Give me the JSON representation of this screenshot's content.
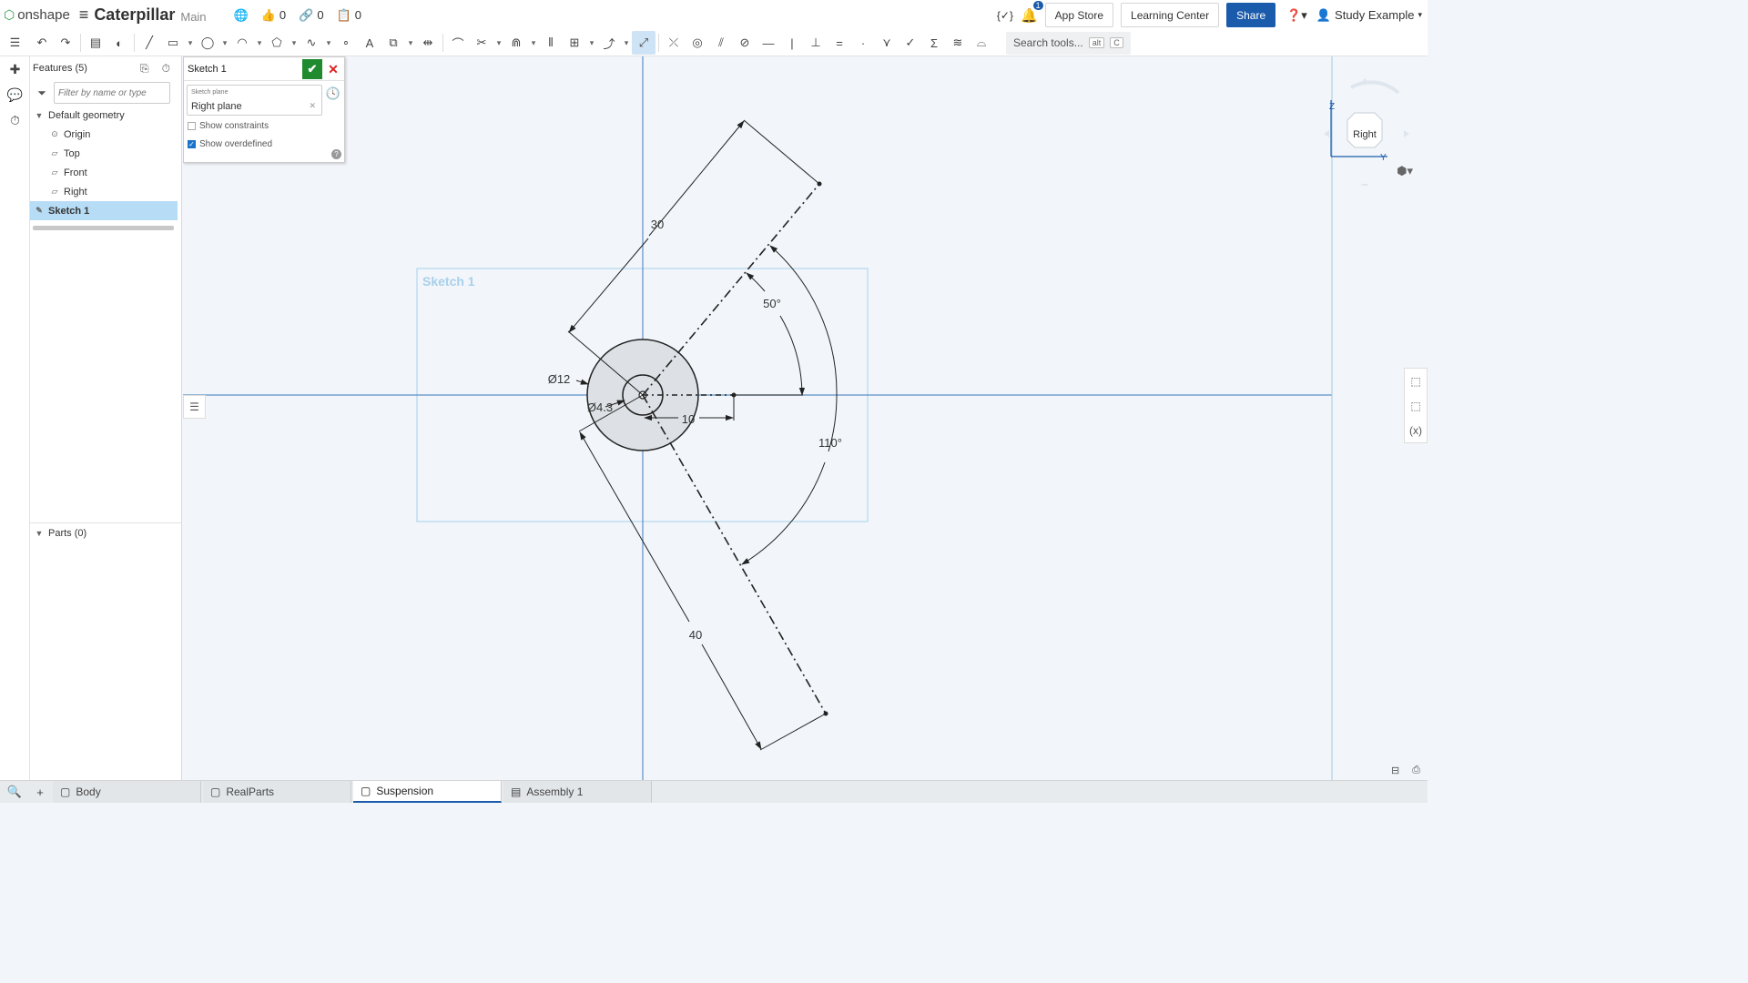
{
  "header": {
    "logo_text": "onshape",
    "document_name": "Caterpillar",
    "branch": "Main",
    "likes": "0",
    "links": "0",
    "copies": "0",
    "notifications": "1",
    "app_store": "App Store",
    "learning_center": "Learning Center",
    "share": "Share",
    "user": "Study Example"
  },
  "toolbar": {
    "search_tools": "Search tools...",
    "shortcut_alt": "alt",
    "shortcut_key": "C"
  },
  "features": {
    "title": "Features (5)",
    "filter_placeholder": "Filter by name or type",
    "default_geometry": "Default geometry",
    "items": [
      "Origin",
      "Top",
      "Front",
      "Right"
    ],
    "sketch": "Sketch 1",
    "parts": "Parts (0)"
  },
  "sketch_dialog": {
    "title": "Sketch 1",
    "plane_label": "Sketch plane",
    "plane_value": "Right plane",
    "show_constraints": "Show constraints",
    "show_constraints_checked": false,
    "show_overdefined": "Show overdefined",
    "show_overdefined_checked": true
  },
  "sketch": {
    "label": "Sketch 1",
    "dim_30": "30",
    "dim_40": "40",
    "dim_50": "50°",
    "dim_110": "110°",
    "dim_d12": "Ø12",
    "dim_d43": "Ø4.3",
    "dim_10": "10"
  },
  "view_cube": {
    "face": "Right",
    "axis_z": "Z",
    "axis_y": "Y"
  },
  "tabs": [
    "Body",
    "RealParts",
    "Suspension",
    "Assembly 1"
  ],
  "active_tab": "Suspension",
  "colors": {
    "accent": "#1a5bab",
    "confirm": "#1f8a2e",
    "selection": "#b7dcf5",
    "sketch_frame": "#a7d0ec"
  }
}
